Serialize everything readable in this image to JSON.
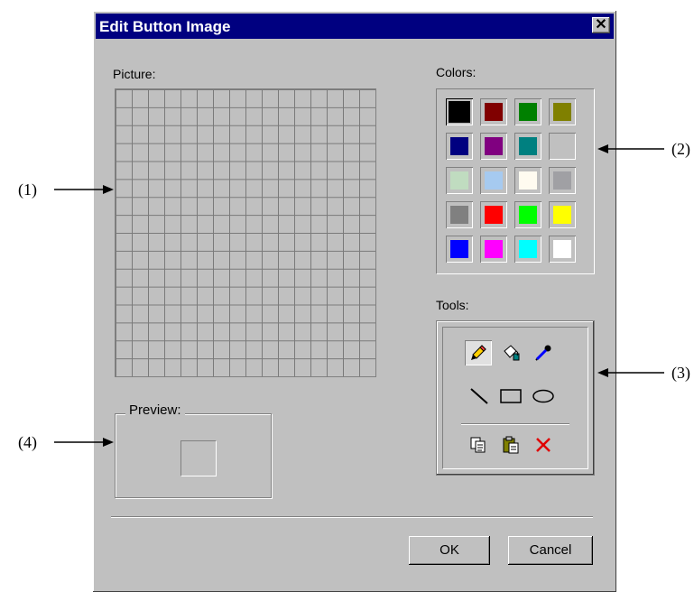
{
  "dialog": {
    "title": "Edit Button Image",
    "close_label": "✕"
  },
  "picture": {
    "label": "Picture:",
    "grid_columns": 16,
    "grid_rows": 16
  },
  "colors": {
    "label": "Colors:",
    "selected_index": 0,
    "swatches": [
      {
        "name": "black",
        "hex": "#000000"
      },
      {
        "name": "dark-red",
        "hex": "#800000"
      },
      {
        "name": "green",
        "hex": "#008000"
      },
      {
        "name": "olive",
        "hex": "#808000"
      },
      {
        "name": "navy",
        "hex": "#000080"
      },
      {
        "name": "purple",
        "hex": "#800080"
      },
      {
        "name": "teal",
        "hex": "#008080"
      },
      {
        "name": "silver",
        "hex": "#c0c0c0"
      },
      {
        "name": "light-green",
        "hex": "#c0dcc0"
      },
      {
        "name": "sky-blue",
        "hex": "#a6caf0"
      },
      {
        "name": "cream",
        "hex": "#fffbf0"
      },
      {
        "name": "medium-gray",
        "hex": "#a0a0a4"
      },
      {
        "name": "gray",
        "hex": "#808080"
      },
      {
        "name": "red",
        "hex": "#ff0000"
      },
      {
        "name": "lime",
        "hex": "#00ff00"
      },
      {
        "name": "yellow",
        "hex": "#ffff00"
      },
      {
        "name": "blue",
        "hex": "#0000ff"
      },
      {
        "name": "magenta",
        "hex": "#ff00ff"
      },
      {
        "name": "cyan",
        "hex": "#00ffff"
      },
      {
        "name": "white",
        "hex": "#ffffff"
      }
    ]
  },
  "tools": {
    "label": "Tools:",
    "active_tool": "pencil",
    "items": [
      "pencil-icon",
      "fill-bucket-icon",
      "eyedropper-icon",
      "line-icon",
      "rectangle-icon",
      "ellipse-icon",
      "copy-icon",
      "paste-icon",
      "clear-icon"
    ]
  },
  "preview": {
    "label": "Preview:"
  },
  "buttons": {
    "ok": "OK",
    "cancel": "Cancel"
  },
  "callouts": {
    "c1": "(1)",
    "c2": "(2)",
    "c3": "(3)",
    "c4": "(4)"
  }
}
